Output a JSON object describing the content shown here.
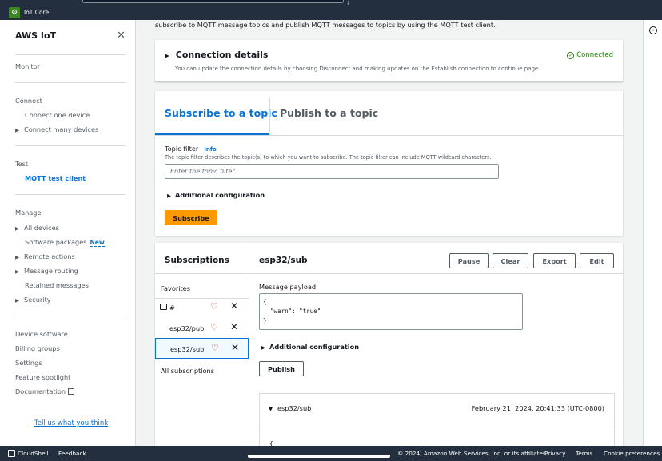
{
  "topbar": {
    "service_name": "IoT Core"
  },
  "sidebar": {
    "title": "AWS IoT",
    "monitor": "Monitor",
    "connect": {
      "heading": "Connect",
      "items": [
        "Connect one device",
        "Connect many devices"
      ]
    },
    "test": {
      "heading": "Test",
      "items": [
        "MQTT test client"
      ]
    },
    "manage": {
      "heading": "Manage",
      "items": [
        "All devices",
        "Software packages",
        "Remote actions",
        "Message routing",
        "Retained messages",
        "Security"
      ],
      "new_badge": "New"
    },
    "bottom_items": [
      "Device software",
      "Billing groups",
      "Settings",
      "Feature spotlight",
      "Documentation"
    ],
    "feedback_link": "Tell us what you think"
  },
  "main": {
    "intro": "subscribe to MQTT message topics and publish MQTT messages to topics by using the MQTT test client.",
    "connection": {
      "title": "Connection details",
      "desc": "You can update the connection details by choosing Disconnect and making updates on the Establish connection to continue page.",
      "status": "Connected"
    },
    "tabs": [
      {
        "label": "Subscribe to a topic"
      },
      {
        "label": "Publish to a topic"
      }
    ],
    "topic_filter": {
      "label": "Topic filter",
      "info": "Info",
      "desc": "The topic filter describes the topic(s) to which you want to subscribe. The topic filter can include MQTT wildcard characters.",
      "placeholder": "Enter the topic filter"
    },
    "additional_config": "Additional configuration",
    "subscribe_button": "Subscribe",
    "subscriptions": {
      "title": "Subscriptions",
      "favorites": "Favorites",
      "items": [
        "#",
        "esp32/pub",
        "esp32/sub"
      ],
      "all": "All subscriptions"
    },
    "topic": {
      "name": "esp32/sub",
      "buttons": {
        "pause": "Pause",
        "clear": "Clear",
        "export": "Export",
        "edit": "Edit"
      },
      "payload_label": "Message payload",
      "payload": "{\n  \"warn\": \"true\"\n}",
      "additional_config": "Additional configuration",
      "publish_button": "Publish",
      "message": {
        "topic": "esp32/sub",
        "timestamp": "February 21, 2024, 20:41:33 (UTC-0800)",
        "body_start": "{"
      }
    }
  },
  "footer": {
    "cloudshell": "CloudShell",
    "feedback": "Feedback",
    "copyright": "© 2024, Amazon Web Services, Inc. or its affiliates.",
    "privacy": "Privacy",
    "terms": "Terms",
    "cookies": "Cookie preferences"
  }
}
